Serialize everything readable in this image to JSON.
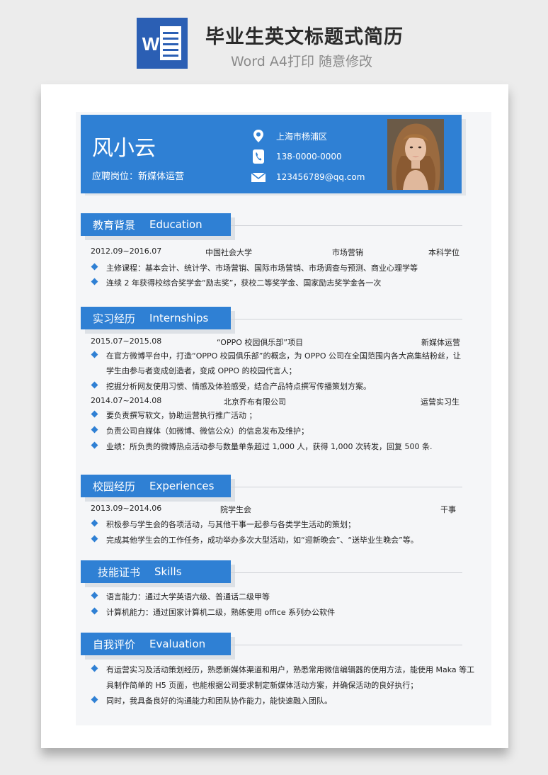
{
  "banner": {
    "icon_letter": "W",
    "title": "毕业生英文标题式简历",
    "subtitle": "Word A4打印 随意修改"
  },
  "profile": {
    "name": "风小云",
    "position": "应聘岗位：新媒体运营",
    "address": "上海市杨浦区",
    "phone": "138-0000-0000",
    "email": "123456789@qq.com"
  },
  "education": {
    "title_cn": "教育背景",
    "title_en": "Education",
    "period": "2012.09~2016.07",
    "school": "中国社会大学",
    "major": "市场营销",
    "degree": "本科学位",
    "bullets": [
      "主修课程：基本会计、统计学、市场营销、国际市场营销、市场调查与预测、商业心理学等",
      "连续 2 年获得校综合奖学金“励志奖”，获校二等奖学金、国家励志奖学金各一次"
    ]
  },
  "internships": {
    "title_cn": "实习经历",
    "title_en": "Internships",
    "job1": {
      "period": "2015.07~2015.08",
      "project": "“OPPO 校园俱乐部”项目",
      "role": "新媒体运营",
      "bullets": [
        "在官方微博平台中，打造“OPPO 校园俱乐部”的概念，为 OPPO 公司在全国范围内各大高集结粉丝，让",
        "学生由参与者变成创造者，变成 OPPO 的校园代言人；",
        "挖掘分析网友使用习惯、情感及体验感受，结合产品特点撰写传播策划方案。"
      ]
    },
    "job2": {
      "period": "2014.07~2014.08",
      "company": "北京乔布有限公司",
      "role": "运营实习生",
      "bullets": [
        "要负责撰写软文，协助运营执行推广活动 ；",
        "负责公司自媒体（如微博、微信公众）的信息发布及维护；",
        "业绩：所负责的微博热点活动参与数量单条超过 1,000 人，获得 1,000 次转发，回复 500 条."
      ]
    }
  },
  "experiences": {
    "title_cn": "校园经历",
    "title_en": "Experiences",
    "period": "2013.09~2014.06",
    "org": "院学生会",
    "role": "干事",
    "bullets": [
      "积极参与学生会的各项活动，与其他干事一起参与各类学生活动的策划；",
      "完成其他学生会的工作任务，成功举办多次大型活动，如“迎新晚会”、“送毕业生晚会”等。"
    ]
  },
  "skills": {
    "title_cn": "技能证书",
    "title_en": "Skills",
    "bullets": [
      "语言能力：通过大学英语六级、普通话二级甲等",
      "计算机能力：通过国家计算机二级，熟练使用 office 系列办公软件"
    ]
  },
  "evaluation": {
    "title_cn": "自我评价",
    "title_en": "Evaluation",
    "bullets": [
      "有运营实习及活动策划经历，熟悉新媒体渠道和用户，熟悉常用微信编辑器的使用方法，能使用 Maka 等工",
      "具制作简单的 H5 页面，也能根据公司要求制定新媒体活动方案，并确保活动的良好执行；",
      "同时，我具备良好的沟通能力和团队协作能力，能快速融入团队。"
    ]
  },
  "colors": {
    "accent": "#2f80d4",
    "word_blue": "#2b5fb4"
  }
}
